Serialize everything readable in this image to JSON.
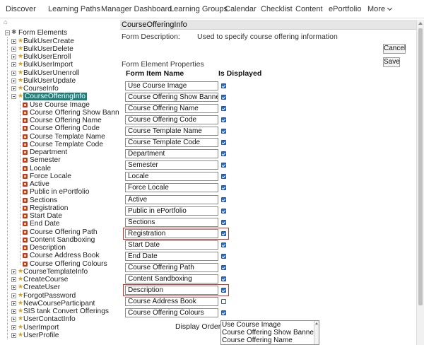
{
  "nav": {
    "items": [
      "Discover",
      "Learning Paths",
      "Manager Dashboard",
      "Learning Groups",
      "Calendar",
      "Checklist",
      "Content",
      "ePortfolio"
    ],
    "more_label": "More"
  },
  "tree": {
    "root": "Form Elements",
    "before": [
      "BulkUserCreate",
      "BulkUserDelete",
      "BulkUserEnroll",
      "BulkUserImport",
      "BulkUserUnenroll",
      "BulkUserUpdate",
      "CourseInfo"
    ],
    "selected": "CourseOfferingInfo",
    "children": [
      "Use Course Image",
      "Course Offering Show Banner",
      "Course Offering Name",
      "Course Offering Code",
      "Course Template Name",
      "Course Template Code",
      "Department",
      "Semester",
      "Locale",
      "Force Locale",
      "Active",
      "Public in ePortfolio",
      "Sections",
      "Registration",
      "Start Date",
      "End Date",
      "Course Offering Path",
      "Content Sandboxing",
      "Description",
      "Course Address Book",
      "Course Offering Colours"
    ],
    "after": [
      "CourseTemplateInfo",
      "CreateCourse",
      "CreateUser",
      "ForgotPassword",
      "NewCourseParticipant",
      "SIS tank Convert Offerings",
      "UserContactInfo",
      "UserImport",
      "UserProfile"
    ]
  },
  "panel": {
    "title": "CourseOfferingInfo",
    "form_description_label": "Form Description:",
    "form_description_value": "Used to specify course offering information",
    "cancel_label": "Cancel",
    "save_label": "Save",
    "properties_title": "Form Element Properties",
    "col_item": "Form Item Name",
    "col_displayed": "Is Displayed",
    "items": [
      {
        "name": "Use Course Image",
        "displayed": true
      },
      {
        "name": "Course Offering Show Banner",
        "displayed": true
      },
      {
        "name": "Course Offering Name",
        "displayed": true
      },
      {
        "name": "Course Offering Code",
        "displayed": true
      },
      {
        "name": "Course Template Name",
        "displayed": true
      },
      {
        "name": "Course Template Code",
        "displayed": true
      },
      {
        "name": "Department",
        "displayed": true
      },
      {
        "name": "Semester",
        "displayed": true
      },
      {
        "name": "Locale",
        "displayed": true
      },
      {
        "name": "Force Locale",
        "displayed": true
      },
      {
        "name": "Active",
        "displayed": true
      },
      {
        "name": "Public in ePortfolio",
        "displayed": true
      },
      {
        "name": "Sections",
        "displayed": true
      },
      {
        "name": "Registration",
        "displayed": true,
        "highlighted": true
      },
      {
        "name": "Start Date",
        "displayed": true
      },
      {
        "name": "End Date",
        "displayed": true
      },
      {
        "name": "Course Offering Path",
        "displayed": true
      },
      {
        "name": "Content Sandboxing",
        "displayed": true
      },
      {
        "name": "Description",
        "displayed": true,
        "highlighted": true
      },
      {
        "name": "Course Address Book",
        "displayed": false
      },
      {
        "name": "Course Offering Colours",
        "displayed": true
      }
    ],
    "display_order_label": "Display Order:",
    "display_order_visible": [
      "Use Course Image",
      "Course Offering Show Banner",
      "Course Offering Name"
    ]
  },
  "colors": {
    "selected_bg": "#1a7f7a",
    "highlight_border": "#c0392b",
    "checkbox_blue": "#2b6cd8"
  }
}
